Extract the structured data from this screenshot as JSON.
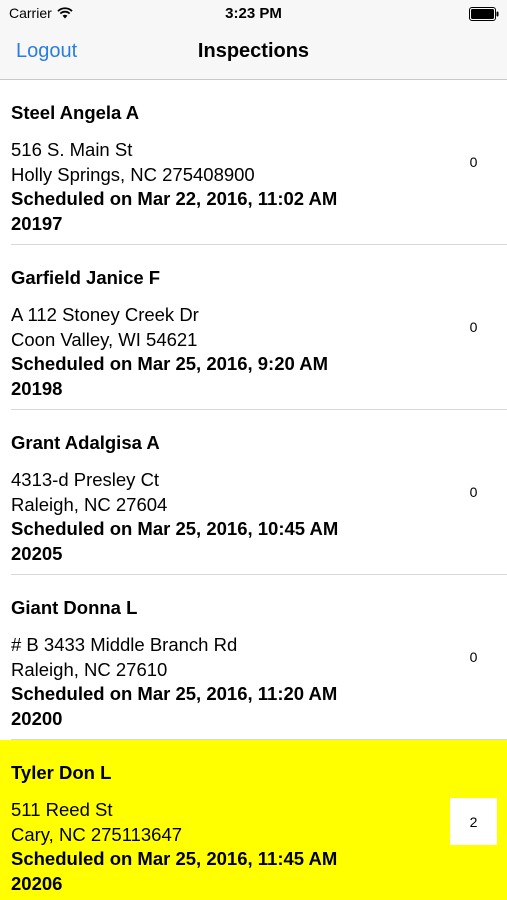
{
  "status_bar": {
    "carrier": "Carrier",
    "wifi_icon": "wifi-icon",
    "time": "3:23 PM",
    "battery_icon": "battery-full-icon"
  },
  "nav": {
    "logout_label": "Logout",
    "title": "Inspections"
  },
  "colors": {
    "accent": "#2a7de1",
    "highlight": "#ffff00"
  },
  "inspections": [
    {
      "name": "Steel Angela A",
      "address1": "516 S. Main St",
      "address2": "Holly Springs, NC 275408900",
      "scheduled": "Scheduled on Mar 22, 2016, 11:02 AM",
      "id": "20197",
      "count": "0",
      "highlighted": false
    },
    {
      "name": "Garfield Janice F",
      "address1": "A 112 Stoney Creek Dr",
      "address2": "Coon Valley, WI 54621",
      "scheduled": "Scheduled on Mar 25, 2016, 9:20 AM",
      "id": "20198",
      "count": "0",
      "highlighted": false
    },
    {
      "name": "Grant Adalgisa A",
      "address1": "4313-d Presley Ct",
      "address2": "Raleigh, NC 27604",
      "scheduled": "Scheduled on Mar 25, 2016, 10:45 AM",
      "id": "20205",
      "count": "0",
      "highlighted": false
    },
    {
      "name": "Giant Donna L",
      "address1": "# B 3433 Middle Branch Rd",
      "address2": "Raleigh, NC 27610",
      "scheduled": "Scheduled on Mar 25, 2016, 11:20 AM",
      "id": "20200",
      "count": "0",
      "highlighted": false
    },
    {
      "name": "Tyler Don L",
      "address1": "511 Reed St",
      "address2": "Cary, NC 275113647",
      "scheduled": "Scheduled on Mar 25, 2016, 11:45 AM",
      "id": "20206",
      "count": "2",
      "highlighted": true
    }
  ]
}
